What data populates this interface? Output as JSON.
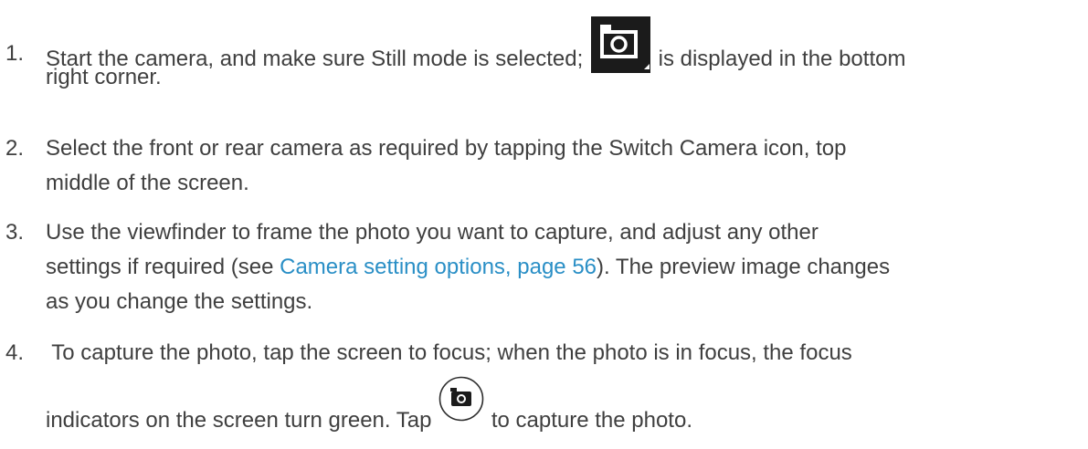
{
  "steps": [
    {
      "number": "1.",
      "text_before_icon": "Start the camera, and make sure Still mode is selected;",
      "icon": "still-mode-camera-icon",
      "text_after_icon": "is displayed in the bottom",
      "continuation": "right corner."
    },
    {
      "number": "2.",
      "line1": "Select the front or rear camera as required by tapping the Switch Camera icon, top",
      "line2": "middle of the screen."
    },
    {
      "number": "3.",
      "line1": "Use the viewfinder to frame the photo you want to capture, and adjust any other",
      "line2_before_link": "settings if required (see ",
      "link_text": "Camera setting options, page 56",
      "line2_after_link": "). The preview image changes",
      "line3": "as you change the settings."
    },
    {
      "number": "4.",
      "line1": " To capture the photo, tap the screen to focus; when the photo is in focus, the focus",
      "line2_before_icon": "indicators on the screen turn green. Tap",
      "icon": "shutter-camera-icon",
      "line2_after_icon": "to capture the photo."
    }
  ],
  "colors": {
    "text": "#3f3f3f",
    "link": "#2a8fc6",
    "icon_dark": "#1b1b1b"
  }
}
